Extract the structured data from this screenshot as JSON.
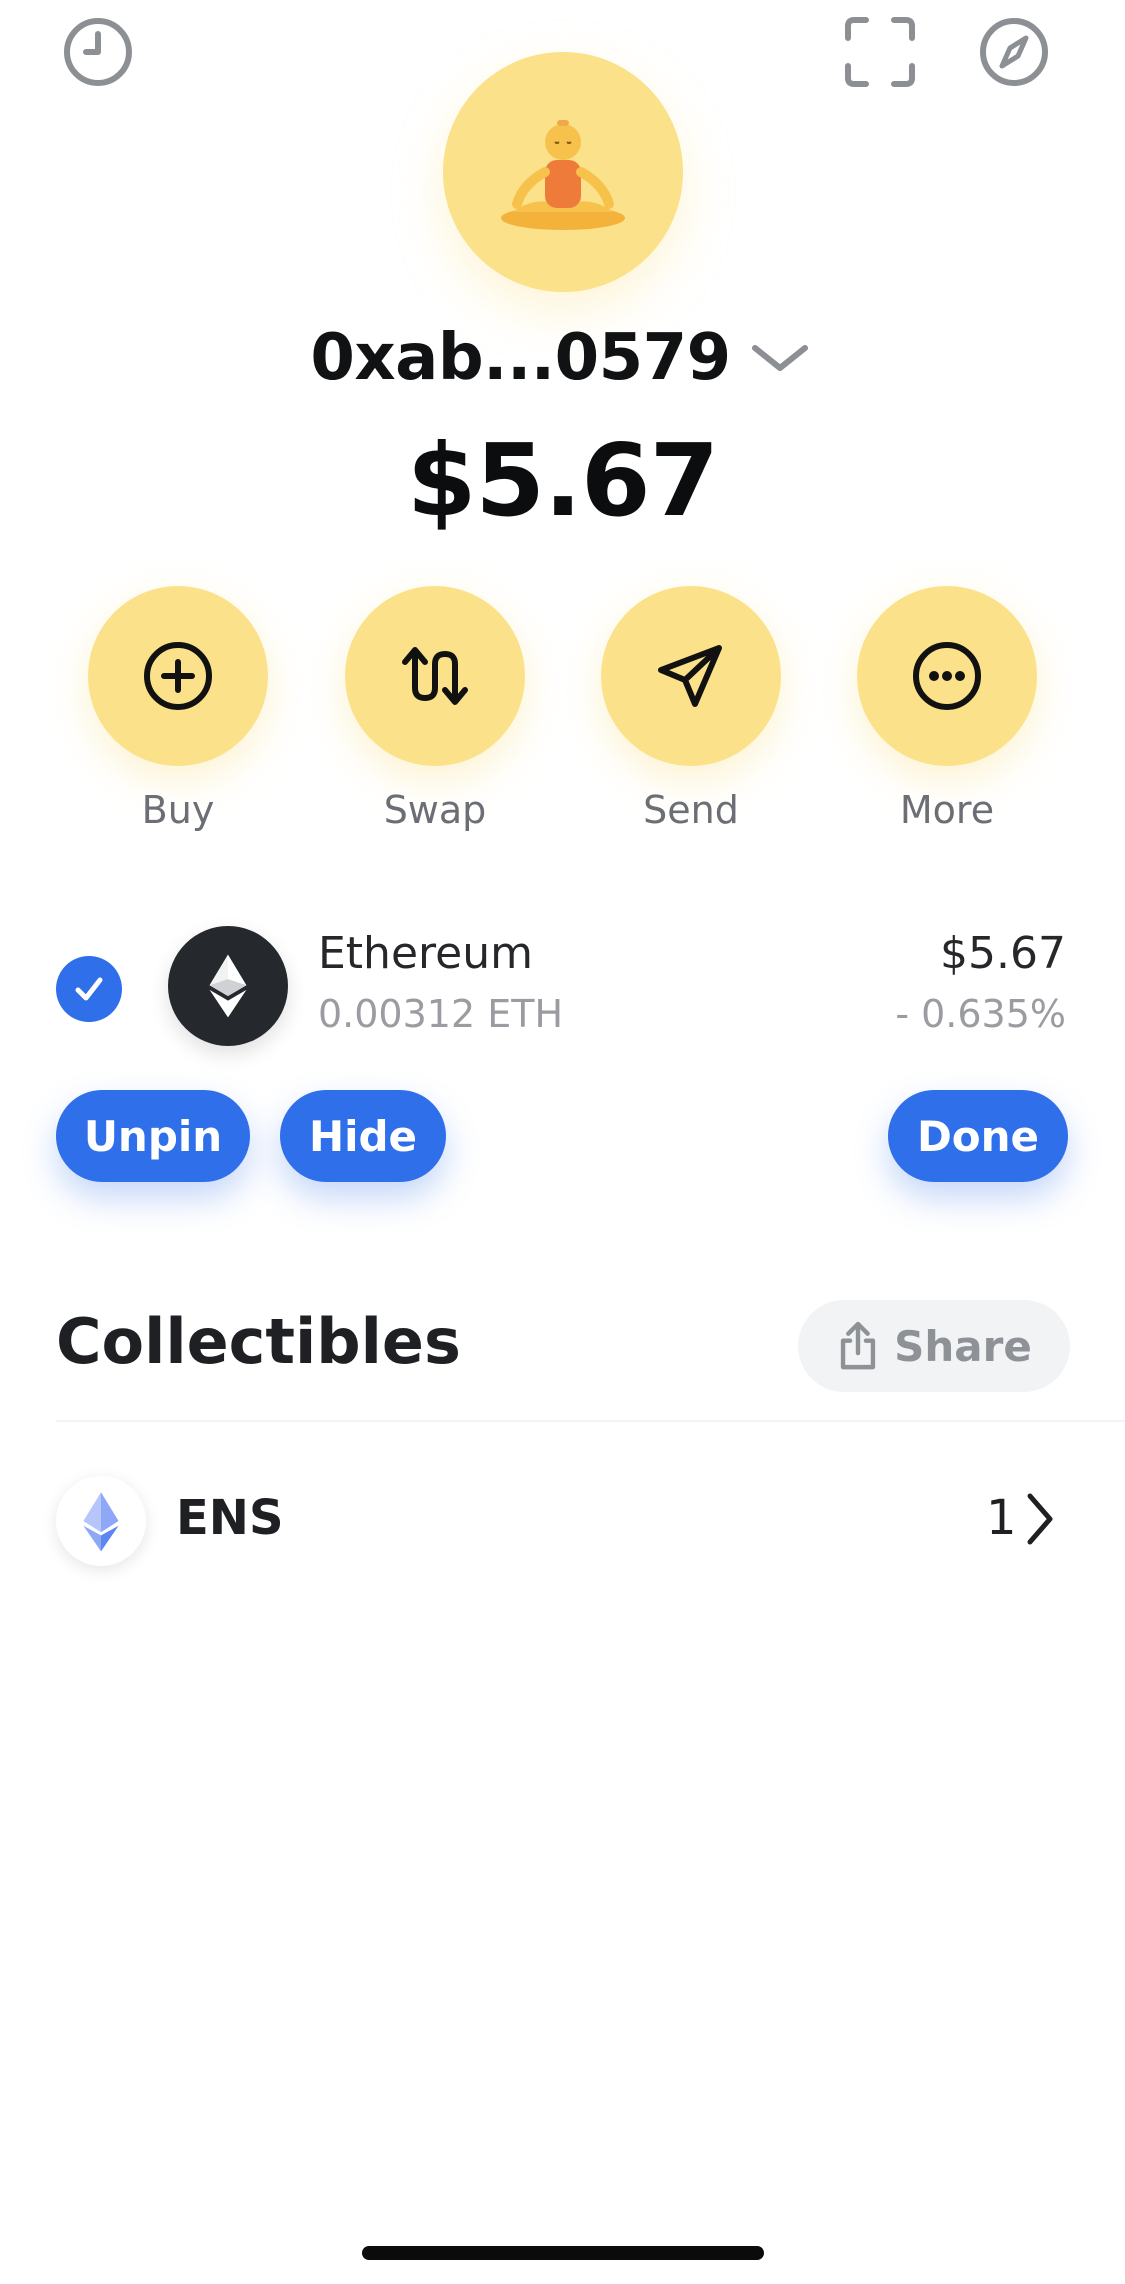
{
  "header": {
    "icons": [
      "history-icon",
      "scan-icon",
      "compass-icon"
    ]
  },
  "wallet": {
    "avatar_emoji": "🧘‍♂️",
    "account_name": "0xab...0579",
    "balance": "$5.67",
    "accent_color": "#fbe189"
  },
  "actions": [
    {
      "label": "Buy",
      "icon": "plus-circle-icon"
    },
    {
      "label": "Swap",
      "icon": "swap-arrows-icon"
    },
    {
      "label": "Send",
      "icon": "paper-plane-icon"
    },
    {
      "label": "More",
      "icon": "more-dots-icon"
    }
  ],
  "token": {
    "name": "Ethereum",
    "balance": "0.00312 ETH",
    "value": "$5.67",
    "change": "- 0.635%",
    "selected": true
  },
  "edit_actions": {
    "unpin": "Unpin",
    "hide": "Hide",
    "done": "Done",
    "color": "#2f6fea"
  },
  "collectibles": {
    "title": "Collectibles",
    "share_label": "Share",
    "items": [
      {
        "name": "ENS",
        "count": "1"
      }
    ]
  }
}
